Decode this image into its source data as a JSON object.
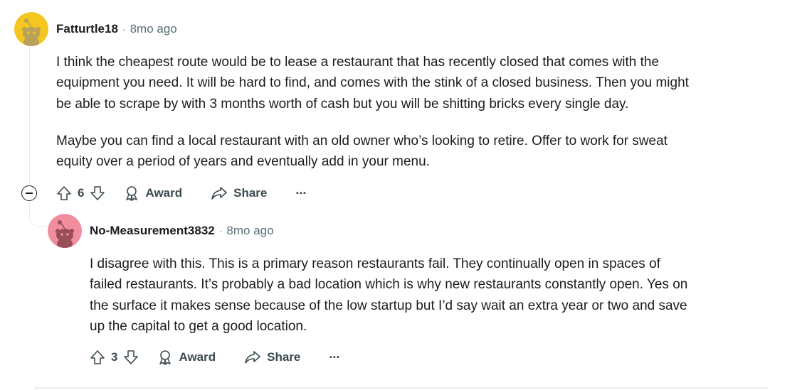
{
  "comments": [
    {
      "username": "Fatturtle18",
      "separator": "·",
      "time": "8mo ago",
      "avatar_color": "#f5c520",
      "paragraphs": [
        [
          "I think the cheapest route would be to lease a restaurant that has recently closed that comes with the",
          "equipment you need. It will be hard to find, and comes with the stink of a closed business. Then you might",
          "be able to scrape by with 3 months worth of cash but you will be shitting bricks every single day."
        ],
        [
          "Maybe you can find a local restaurant with an old owner who’s looking to retire. Offer to work for sweat",
          "equity over a period of years and eventually add in your menu."
        ]
      ],
      "votes": "6",
      "award_label": "Award",
      "share_label": "Share",
      "more_label": "···"
    },
    {
      "username": "No-Measurement3832",
      "separator": "·",
      "time": "8mo ago",
      "avatar_color": "#f08e9e",
      "paragraphs": [
        [
          "I disagree with this. This is a primary reason restaurants fail. They continually open in spaces of",
          "failed restaurants. It’s probably a bad location which is why new restaurants constantly open. Yes on",
          "the surface it makes sense because of the low startup but I’d say wait an extra year or two and save",
          "up the capital to get a good location."
        ]
      ],
      "votes": "3",
      "award_label": "Award",
      "share_label": "Share",
      "more_label": "···"
    }
  ],
  "icons": {
    "upvote": "upvote-arrow-icon",
    "downvote": "downvote-arrow-icon",
    "award": "award-ribbon-icon",
    "share": "share-arrow-icon",
    "collapse": "collapse-minus-icon"
  }
}
